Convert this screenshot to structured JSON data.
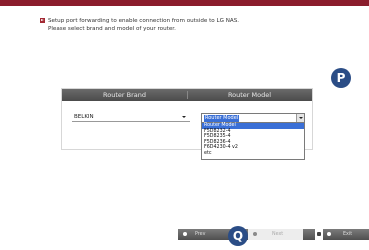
{
  "instructions": {
    "line1": "Setup port forwarding to enable connection from outside to LG NAS.",
    "line2": "Please select brand and model of your router."
  },
  "table": {
    "headers": [
      "Router Brand",
      "Router Model"
    ]
  },
  "brand_select": {
    "value": "BELKIN"
  },
  "model_select": {
    "value": "Router Model",
    "options": [
      "Router Model",
      "F5D8232-4",
      "F5D8235-4",
      "F5D8236-4",
      "F6D4230-4 v2",
      "etc"
    ]
  },
  "badges": {
    "p": "P",
    "q": "Q"
  },
  "nav": {
    "prev": "Prev",
    "next": "Next",
    "exit": "Exit"
  },
  "colors": {
    "accent": "#8b1d2c",
    "badge": "#2b4d86",
    "selection": "#3a6fd6"
  }
}
